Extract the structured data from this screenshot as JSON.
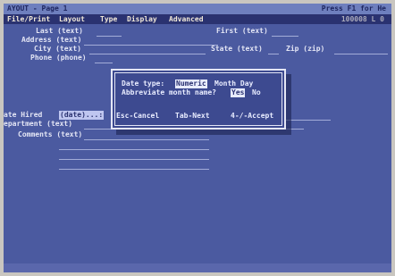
{
  "titlebar": {
    "left": "AYOUT - Page 1",
    "right": "Press F1 for He"
  },
  "menu": {
    "items": [
      "File/Print",
      "Layout",
      "Type",
      "Display",
      "Advanced"
    ],
    "right": "100008 L 0"
  },
  "form": {
    "last": "Last (text)",
    "first": "First (text)",
    "address": "Address (text)",
    "city": "City (text)",
    "state": "State (text)",
    "zip": "Zip (zip)",
    "phone": "Phone (phone)",
    "date_hired_label": "ate Hired",
    "date_hired_value": "(date)...:",
    "department": "epartment (text)",
    "comments": "Comments (text)"
  },
  "dialog": {
    "date_type_label": "Date type:",
    "date_type_selected": "Numeric",
    "date_type_other": "Month Day",
    "abbrev_label": "Abbreviate month name?",
    "abbrev_selected": "Yes",
    "abbrev_other": "No",
    "esc": "Esc-Cancel",
    "tab": "Tab-Next",
    "accept": "4-/-Accept"
  }
}
